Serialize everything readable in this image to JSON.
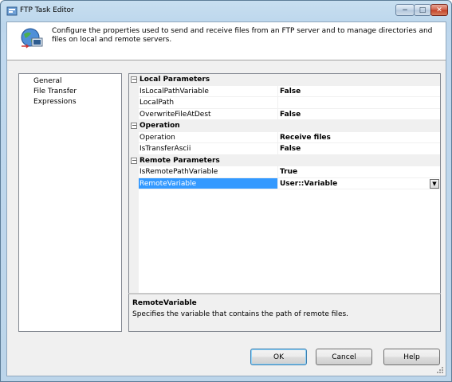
{
  "window": {
    "title": "FTP Task Editor"
  },
  "header": {
    "description": "Configure the properties used to send and receive files from an FTP server and to manage directories and files on local and remote servers."
  },
  "nav": {
    "items": [
      {
        "label": "General"
      },
      {
        "label": "File Transfer"
      },
      {
        "label": "Expressions"
      }
    ]
  },
  "properties": {
    "categories": [
      {
        "name": "Local Parameters",
        "toggle": "−",
        "rows": [
          {
            "name": "IsLocalPathVariable",
            "value": "False"
          },
          {
            "name": "LocalPath",
            "value": ""
          },
          {
            "name": "OverwriteFileAtDest",
            "value": "False"
          }
        ]
      },
      {
        "name": "Operation",
        "toggle": "−",
        "rows": [
          {
            "name": "Operation",
            "value": "Receive files"
          },
          {
            "name": "IsTransferAscii",
            "value": "False"
          }
        ]
      },
      {
        "name": "Remote Parameters",
        "toggle": "−",
        "rows": [
          {
            "name": "IsRemotePathVariable",
            "value": "True"
          },
          {
            "name": "RemoteVariable",
            "value": "User::Variable",
            "selected": true
          }
        ]
      }
    ],
    "dropdown_glyph": "▼"
  },
  "description_panel": {
    "title": "RemoteVariable",
    "text": "Specifies the variable that contains the path of remote files."
  },
  "buttons": {
    "ok": "OK",
    "cancel": "Cancel",
    "help": "Help"
  },
  "titlebar_buttons": {
    "minimize": "−",
    "maximize": "□",
    "close": "✕"
  },
  "colors": {
    "selection": "#3399ff",
    "titlebar": "#c0d8ee"
  }
}
